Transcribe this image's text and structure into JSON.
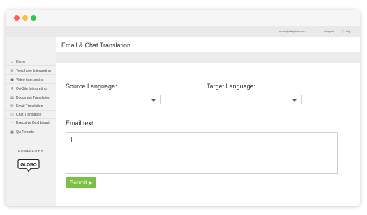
{
  "window": {
    "controls": [
      "close",
      "minimize",
      "maximize"
    ]
  },
  "topbar": {
    "user_email": "demo@talkglobo.com",
    "logout_label": "Logout",
    "help_label": "Help"
  },
  "sidebar": {
    "items": [
      {
        "label": "Home",
        "icon": "home-icon"
      },
      {
        "label": "Telephone Interpreting",
        "icon": "phone-icon"
      },
      {
        "label": "Video Interpreting",
        "icon": "video-icon"
      },
      {
        "label": "On-Site Interpreting",
        "icon": "location-pin-icon"
      },
      {
        "label": "Document Translation",
        "icon": "document-icon"
      },
      {
        "label": "Email Translation",
        "icon": "email-icon"
      },
      {
        "label": "Chat Translation",
        "icon": "chat-icon"
      },
      {
        "label": "Executive Dashboard",
        "icon": "dashboard-icon"
      },
      {
        "label": "QA Reports",
        "icon": "report-icon"
      }
    ],
    "powered_by": "POWERED BY",
    "logo_text": "GLOBO"
  },
  "main": {
    "page_title": "Email & Chat Translation",
    "source_language_label": "Source Language:",
    "source_language_value": "",
    "target_language_label": "Target Language:",
    "target_language_value": "",
    "email_text_label": "Email text:",
    "email_text_value": "",
    "submit_label": "Submit"
  },
  "colors": {
    "accent": "#7bc046",
    "close": "#fc605c",
    "minimize": "#fdbc40",
    "maximize": "#34c84a"
  }
}
